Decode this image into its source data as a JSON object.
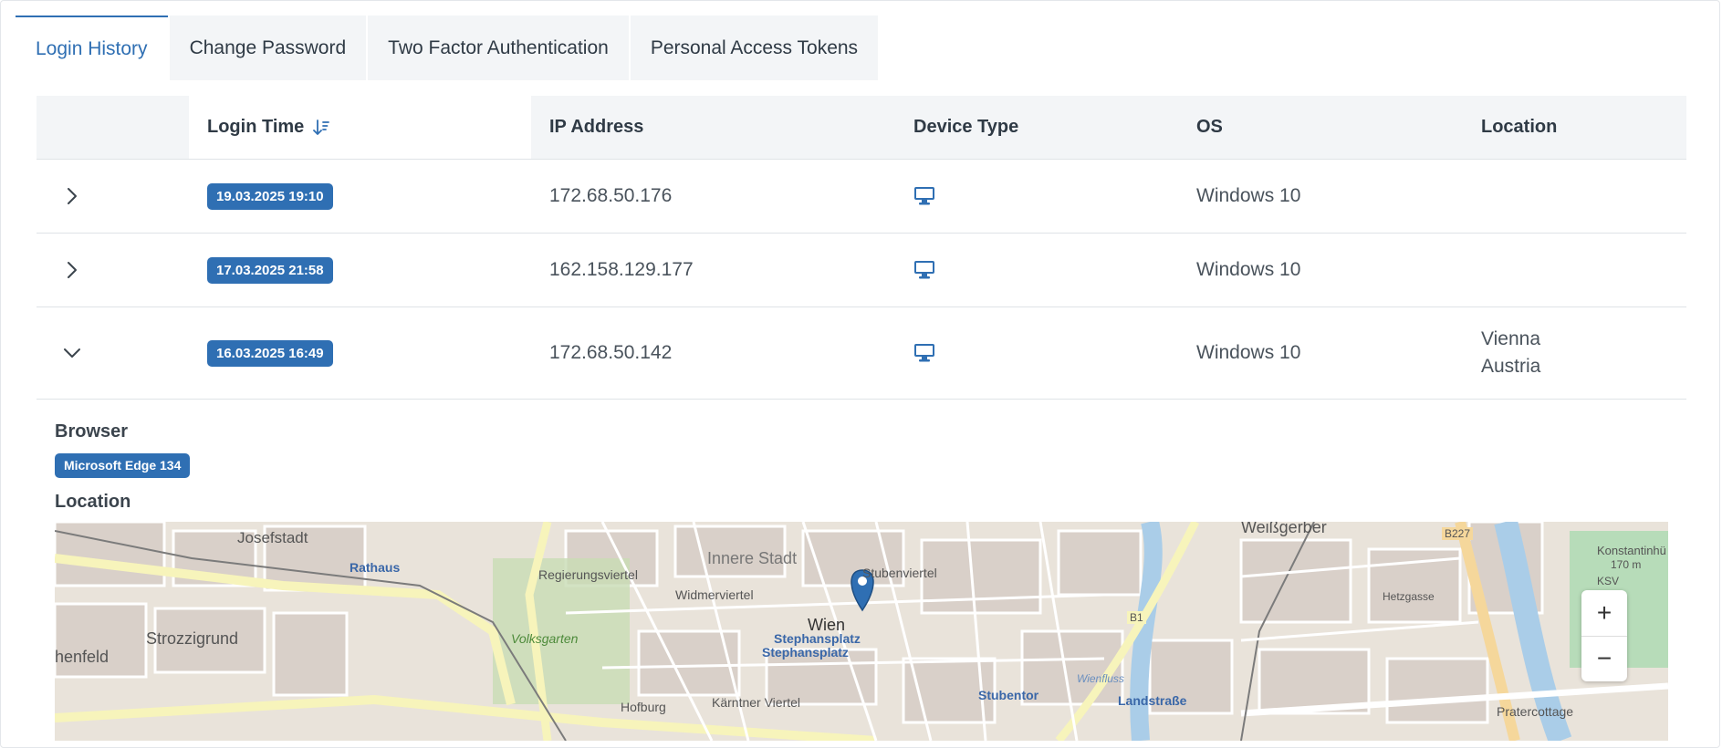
{
  "tabs": [
    {
      "label": "Login History"
    },
    {
      "label": "Change Password"
    },
    {
      "label": "Two Factor Authentication"
    },
    {
      "label": "Personal Access Tokens"
    }
  ],
  "table": {
    "headers": {
      "login_time": "Login Time",
      "ip": "IP Address",
      "device": "Device Type",
      "os": "OS",
      "location": "Location"
    },
    "rows": [
      {
        "time": "19.03.2025 19:10",
        "ip": "172.68.50.176",
        "device_icon": "desktop-icon",
        "os": "Windows 10",
        "city": "",
        "country": "",
        "expanded": false
      },
      {
        "time": "17.03.2025 21:58",
        "ip": "162.158.129.177",
        "device_icon": "desktop-icon",
        "os": "Windows 10",
        "city": "",
        "country": "",
        "expanded": false
      },
      {
        "time": "16.03.2025 16:49",
        "ip": "172.68.50.142",
        "device_icon": "desktop-icon",
        "os": "Windows 10",
        "city": "Vienna",
        "country": "Austria",
        "expanded": true
      }
    ]
  },
  "detail": {
    "browser_label": "Browser",
    "browser_value": "Microsoft Edge 134",
    "location_label": "Location"
  },
  "map": {
    "labels": {
      "josefstadt": "Josefstadt",
      "rathaus": "Rathaus",
      "regierungsviertel": "Regierungsviertel",
      "innere_stadt": "Innere Stadt",
      "stubenviertel": "Stubenviertel",
      "widmerviertel": "Widmerviertel",
      "wien": "Wien",
      "stephansplatz1": "Stephansplatz",
      "stephansplatz2": "Stephansplatz",
      "volksgarten": "Volksgarten",
      "strozzigrund": "Strozzigrund",
      "henfeld": "henfeld",
      "hofburg": "Hofburg",
      "karntner_viertel": "Kärntner Viertel",
      "stubentor": "Stubentor",
      "landstrasse": "Landstraße",
      "weissgerber": "Weißgerber",
      "b227": "B227",
      "b1": "B1",
      "pratercottage": "Pratercottage",
      "konstantinhu": "Konstantinhü",
      "elev": "170 m",
      "ksv": "KSV",
      "wienfluss": "Wienfluss",
      "hetzgasse": "Hetzgasse"
    },
    "zoom_in": "+",
    "zoom_out": "−"
  },
  "colors": {
    "accent": "#2f6fb3",
    "header_bg": "#f3f5f7"
  }
}
